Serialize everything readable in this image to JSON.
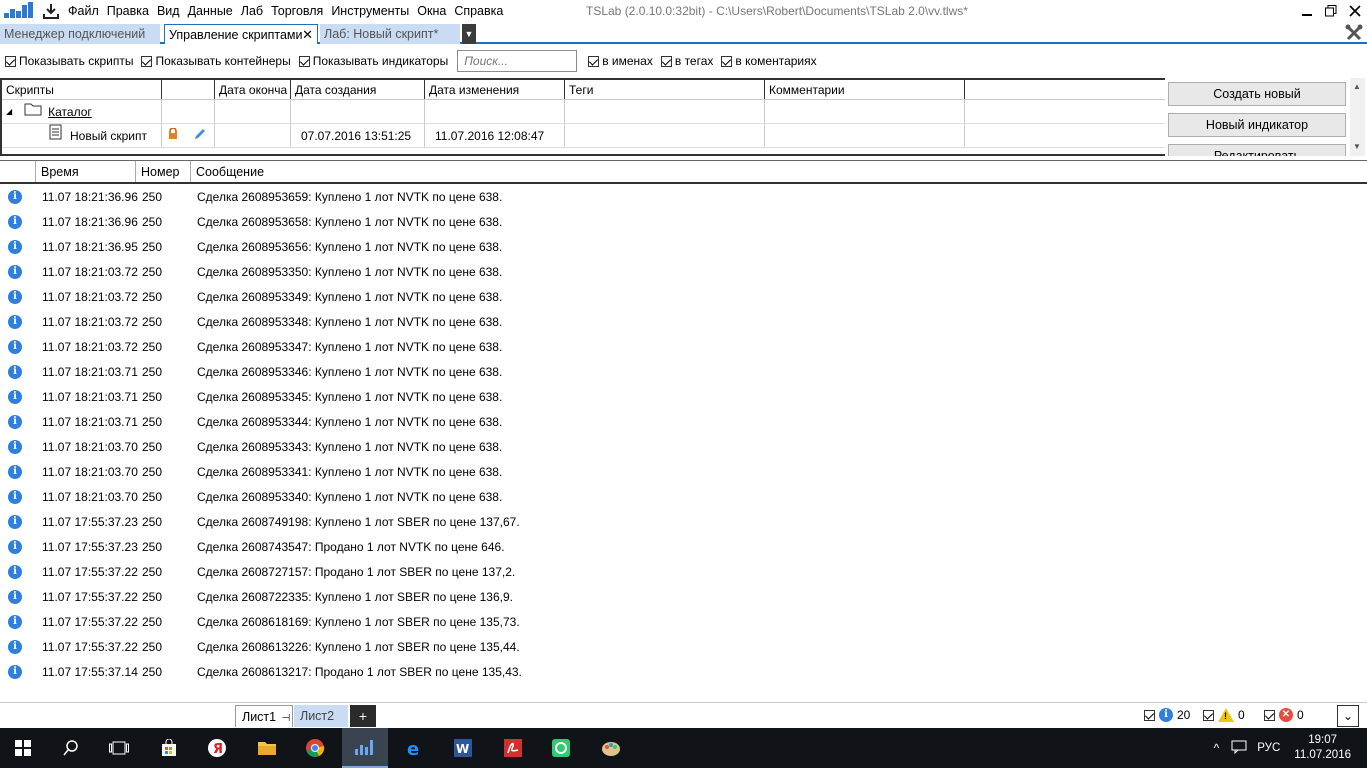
{
  "menu": {
    "items": [
      "Файл",
      "Правка",
      "Вид",
      "Данные",
      "Лаб",
      "Торговля",
      "Инструменты",
      "Окна",
      "Справка"
    ]
  },
  "window": {
    "title": "TSLab (2.0.10.0:32bit) - C:\\Users\\Robert\\Documents\\TSLab 2.0\\vv.tlws*"
  },
  "tabs": {
    "connection_manager": "Менеджер подключений",
    "script_management": "Управление скриптами",
    "lab": "Лаб: Новый скрипт*"
  },
  "filters": {
    "show_scripts": "Показывать скрипты",
    "show_containers": "Показывать контейнеры",
    "show_indicators": "Показывать индикаторы",
    "search_placeholder": "Поиск...",
    "in_names": "в именах",
    "in_tags": "в тегах",
    "in_comments": "в коментариях"
  },
  "scripts_grid": {
    "columns": [
      "Скрипты",
      "",
      "Дата оконча",
      "Дата создания",
      "Дата изменения",
      "Теги",
      "Комментарии"
    ],
    "folder": {
      "name": "Каталог"
    },
    "script": {
      "name": "Новый скрипт",
      "created": "07.07.2016 13:51:25",
      "modified": "11.07.2016 12:08:47"
    }
  },
  "sidebar": {
    "create_new": "Создать новый",
    "new_indicator": "Новый индикатор",
    "edit": "Редактировать"
  },
  "log": {
    "columns": [
      "Время",
      "Номер",
      "Сообщение"
    ],
    "rows": [
      {
        "time": "11.07 18:21:36.96",
        "number": "250",
        "message": "Сделка 2608953659: Куплено 1 лот NVTK по цене 638."
      },
      {
        "time": "11.07 18:21:36.96",
        "number": "250",
        "message": "Сделка 2608953658: Куплено 1 лот NVTK по цене 638."
      },
      {
        "time": "11.07 18:21:36.95",
        "number": "250",
        "message": "Сделка 2608953656: Куплено 1 лот NVTK по цене 638."
      },
      {
        "time": "11.07 18:21:03.72",
        "number": "250",
        "message": "Сделка 2608953350: Куплено 1 лот NVTK по цене 638."
      },
      {
        "time": "11.07 18:21:03.72",
        "number": "250",
        "message": "Сделка 2608953349: Куплено 1 лот NVTK по цене 638."
      },
      {
        "time": "11.07 18:21:03.72",
        "number": "250",
        "message": "Сделка 2608953348: Куплено 1 лот NVTK по цене 638."
      },
      {
        "time": "11.07 18:21:03.72",
        "number": "250",
        "message": "Сделка 2608953347: Куплено 1 лот NVTK по цене 638."
      },
      {
        "time": "11.07 18:21:03.71",
        "number": "250",
        "message": "Сделка 2608953346: Куплено 1 лот NVTK по цене 638."
      },
      {
        "time": "11.07 18:21:03.71",
        "number": "250",
        "message": "Сделка 2608953345: Куплено 1 лот NVTK по цене 638."
      },
      {
        "time": "11.07 18:21:03.71",
        "number": "250",
        "message": "Сделка 2608953344: Куплено 1 лот NVTK по цене 638."
      },
      {
        "time": "11.07 18:21:03.70",
        "number": "250",
        "message": "Сделка 2608953343: Куплено 1 лот NVTK по цене 638."
      },
      {
        "time": "11.07 18:21:03.70",
        "number": "250",
        "message": "Сделка 2608953341: Куплено 1 лот NVTK по цене 638."
      },
      {
        "time": "11.07 18:21:03.70",
        "number": "250",
        "message": "Сделка 2608953340: Куплено 1 лот NVTK по цене 638."
      },
      {
        "time": "11.07 17:55:37.23",
        "number": "250",
        "message": "Сделка 2608749198: Куплено 1 лот SBER по цене 137,67."
      },
      {
        "time": "11.07 17:55:37.23",
        "number": "250",
        "message": "Сделка 2608743547: Продано 1 лот NVTK по цене 646."
      },
      {
        "time": "11.07 17:55:37.22",
        "number": "250",
        "message": "Сделка 2608727157: Продано 1 лот SBER по цене 137,2."
      },
      {
        "time": "11.07 17:55:37.22",
        "number": "250",
        "message": "Сделка 2608722335: Куплено 1 лот SBER по цене 136,9."
      },
      {
        "time": "11.07 17:55:37.22",
        "number": "250",
        "message": "Сделка 2608618169: Куплено 1 лот SBER по цене 135,73."
      },
      {
        "time": "11.07 17:55:37.22",
        "number": "250",
        "message": "Сделка 2608613226: Куплено 1 лот SBER по цене 135,44."
      },
      {
        "time": "11.07 17:55:37.14",
        "number": "250",
        "message": "Сделка 2608613217: Продано 1 лот SBER по цене 135,43."
      }
    ]
  },
  "bottom": {
    "sheet1": "Лист1",
    "sheet2": "Лист2",
    "add_sheet": "+",
    "info_count": "20",
    "warning_count": "0",
    "error_count": "0"
  },
  "taskbar": {
    "language": "РУС",
    "time": "19:07",
    "date": "11.07.2016",
    "icons": [
      "windows-start-icon",
      "search-icon",
      "task-view-icon",
      "store-icon",
      "yandex-browser-icon",
      "file-explorer-icon",
      "chrome-icon",
      "tslab-icon",
      "edge-icon",
      "word-icon",
      "acrobat-icon",
      "quik-icon",
      "paint-icon"
    ]
  },
  "colors": {
    "accent": "#1f6fbf",
    "inactive_tab": "#c9dcf3",
    "info_icon": "#2f7fe0",
    "taskbar": "#101418"
  }
}
